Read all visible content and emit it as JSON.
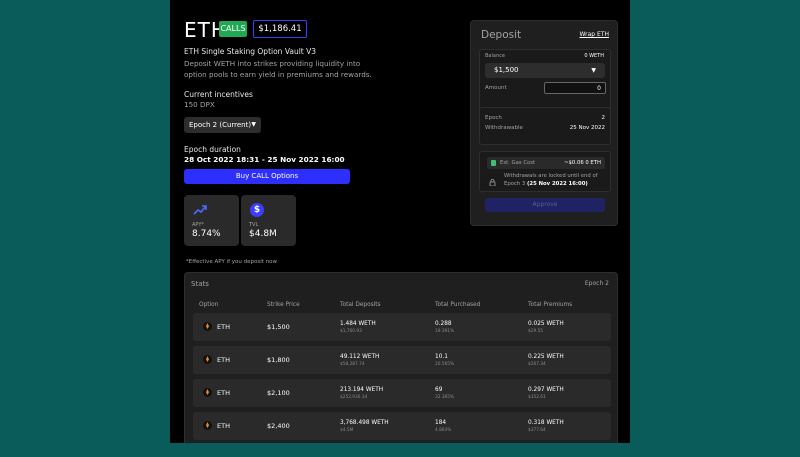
{
  "header": {
    "asset": "ETH",
    "type_badge": "CALLS",
    "price": "$1,186.41"
  },
  "vault": {
    "name": "ETH Single Staking Option Vault V3",
    "description": "Deposit WETH into strikes providing liquidity into option pools to earn yield in premiums and rewards."
  },
  "incentives": {
    "label": "Current incentives",
    "value": "150 DPX"
  },
  "epoch_selector": {
    "value": "Epoch 2 (Current)"
  },
  "duration": {
    "label": "Epoch duration",
    "value": "28 Oct 2022 18:31 - 25 Nov 2022 16:00"
  },
  "buy_button": "Buy CALL Options",
  "cards": {
    "apy_label": "APY*",
    "apy_value": "8.74%",
    "tvl_label": "TVL",
    "tvl_value": "$4.8M"
  },
  "footnote": "*Effective APY if you deposit now",
  "deposit": {
    "title": "Deposit",
    "wrap_link": "Wrap ETH",
    "balance_label": "Balance",
    "balance_value": "0 WETH",
    "strike_selected": "$1,500",
    "amount_label": "Amount",
    "amount_value": "0",
    "epoch_label": "Epoch",
    "epoch_value": "2",
    "withdrawable_label": "Withdrawable",
    "withdrawable_value": "25 Nov 2022",
    "gas_label": "Est. Gas Cost",
    "gas_value": "~$0.06  0 ETH",
    "lock_text_pre": "Withdrawals are locked until end of Epoch 3",
    "lock_text_bold": "(25 Nov 2022 16:00)",
    "approve_button": "Approve"
  },
  "stats": {
    "title": "Stats",
    "epoch": "Epoch 2",
    "columns": [
      "Option",
      "Strike Price",
      "Total Deposits",
      "Total Purchased",
      "Total Premiums"
    ],
    "rows": [
      {
        "option": "ETH",
        "strike": "$1,500",
        "deposits": "1.484 WETH",
        "deposits_usd": "$1,760.93",
        "purchased": "0.288",
        "purchased_pct": "19.391%",
        "premiums": "0.025 WETH",
        "premiums_usd": "$29.55"
      },
      {
        "option": "ETH",
        "strike": "$1,800",
        "deposits": "49.112 WETH",
        "deposits_usd": "$58,287.74",
        "purchased": "10.1",
        "purchased_pct": "20.565%",
        "premiums": "0.225 WETH",
        "premiums_usd": "$267.34"
      },
      {
        "option": "ETH",
        "strike": "$2,100",
        "deposits": "213.194 WETH",
        "deposits_usd": "$252,936.34",
        "purchased": "69",
        "purchased_pct": "32.365%",
        "premiums": "0.297 WETH",
        "premiums_usd": "$352.61"
      },
      {
        "option": "ETH",
        "strike": "$2,400",
        "deposits": "3,768.498 WETH",
        "deposits_usd": "$4.5M",
        "purchased": "184",
        "purchased_pct": "4.883%",
        "premiums": "0.318 WETH",
        "premiums_usd": "$377.64"
      }
    ]
  },
  "colors": {
    "background": "#0a5c5a",
    "accent_blue": "#2d2ffd",
    "calls_green": "#21a855"
  }
}
